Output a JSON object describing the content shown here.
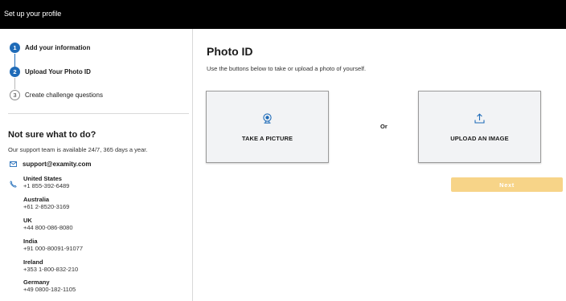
{
  "header": {
    "title": "Set up your profile"
  },
  "steps": [
    {
      "number": "1",
      "label": "Add your information",
      "state": "complete"
    },
    {
      "number": "2",
      "label": "Upload Your Photo ID",
      "state": "current"
    },
    {
      "number": "3",
      "label": "Create challenge questions",
      "state": "pending"
    }
  ],
  "help": {
    "title": "Not sure what to do?",
    "description": "Our support team is available 24/7, 365 days a year.",
    "email": "support@examity.com",
    "icons": {
      "email": "mail-icon",
      "phone": "phone-icon"
    },
    "contacts": [
      {
        "country": "United States",
        "phone": "+1 855-392-6489"
      },
      {
        "country": "Australia",
        "phone": "+61 2-8520-3169"
      },
      {
        "country": "UK",
        "phone": "+44 800-086-8080"
      },
      {
        "country": "India",
        "phone": "+91 000-80091-91077"
      },
      {
        "country": "Ireland",
        "phone": "+353 1-800-832-210"
      },
      {
        "country": "Germany",
        "phone": "+49 0800-182-1105"
      }
    ]
  },
  "main": {
    "title": "Photo ID",
    "description": "Use the buttons below to take or upload a photo of yourself.",
    "take_picture": {
      "label": "TAKE A PICTURE",
      "icon": "webcam-icon"
    },
    "or_label": "Or",
    "upload_image": {
      "label": "UPLOAD AN IMAGE",
      "icon": "upload-icon"
    },
    "next_label": "Next"
  },
  "colors": {
    "accent": "#1f6bb8",
    "header_bg": "#000000",
    "next_disabled": "#f7d488",
    "option_bg": "#f2f3f5"
  }
}
